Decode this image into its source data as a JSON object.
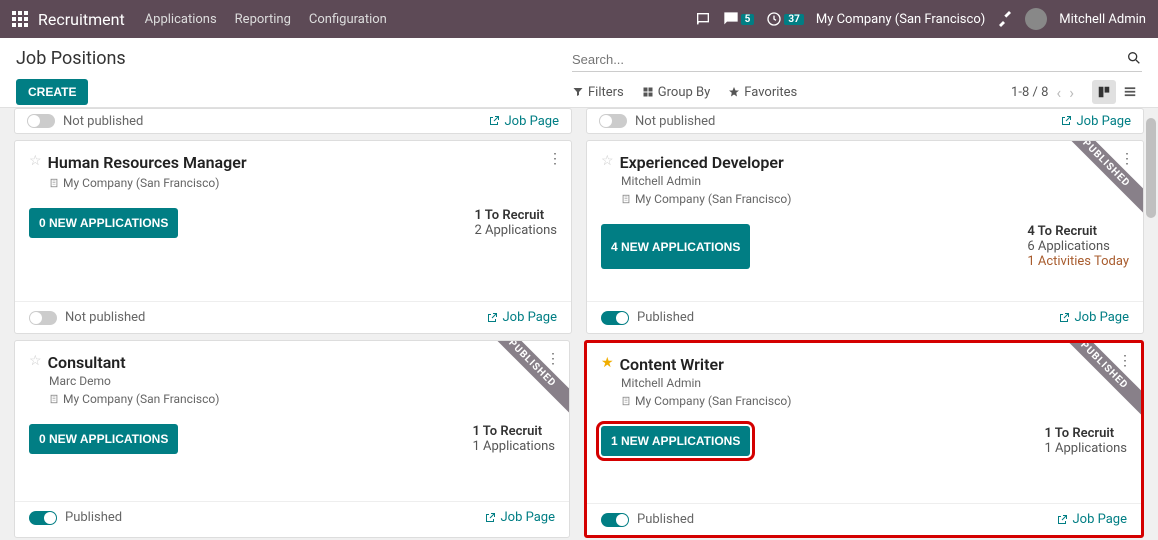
{
  "topbar": {
    "brand": "Recruitment",
    "nav": [
      "Applications",
      "Reporting",
      "Configuration"
    ],
    "msg_badge": "5",
    "clock_badge": "37",
    "company": "My Company (San Francisco)",
    "user": "Mitchell Admin"
  },
  "header": {
    "title": "Job Positions",
    "create": "CREATE",
    "search_placeholder": "Search...",
    "filters": "Filters",
    "groupby": "Group By",
    "favorites": "Favorites",
    "pager": "1-8 / 8"
  },
  "partial": {
    "left": {
      "pub": "Not published",
      "link": "Job Page"
    },
    "right": {
      "pub": "Not published",
      "link": "Job Page"
    }
  },
  "cards": [
    {
      "title": "Human Resources Manager",
      "sub": "",
      "company": "My Company (San Francisco)",
      "app_btn": "0 NEW APPLICATIONS",
      "recruit": "1 To Recruit",
      "apps": "2 Applications",
      "activities": "",
      "published": false,
      "pub_text": "Not published",
      "ribbon": "",
      "star": false,
      "jp": "Job Page"
    },
    {
      "title": "Experienced Developer",
      "sub": "Mitchell Admin",
      "company": "My Company (San Francisco)",
      "app_btn": "4 NEW APPLICATIONS",
      "recruit": "4 To Recruit",
      "apps": "6 Applications",
      "activities": "1 Activities Today",
      "published": true,
      "pub_text": "Published",
      "ribbon": "PUBLISHED",
      "star": false,
      "jp": "Job Page"
    },
    {
      "title": "Consultant",
      "sub": "Marc Demo",
      "company": "My Company (San Francisco)",
      "app_btn": "0 NEW APPLICATIONS",
      "recruit": "1 To Recruit",
      "apps": "1 Applications",
      "activities": "",
      "published": true,
      "pub_text": "Published",
      "ribbon": "PUBLISHED",
      "star": false,
      "jp": "Job Page"
    },
    {
      "title": "Content Writer",
      "sub": "Mitchell Admin",
      "company": "My Company (San Francisco)",
      "app_btn": "1 NEW APPLICATIONS",
      "recruit": "1 To Recruit",
      "apps": "1 Applications",
      "activities": "",
      "published": true,
      "pub_text": "Published",
      "ribbon": "PUBLISHED",
      "star": true,
      "jp": "Job Page"
    }
  ]
}
